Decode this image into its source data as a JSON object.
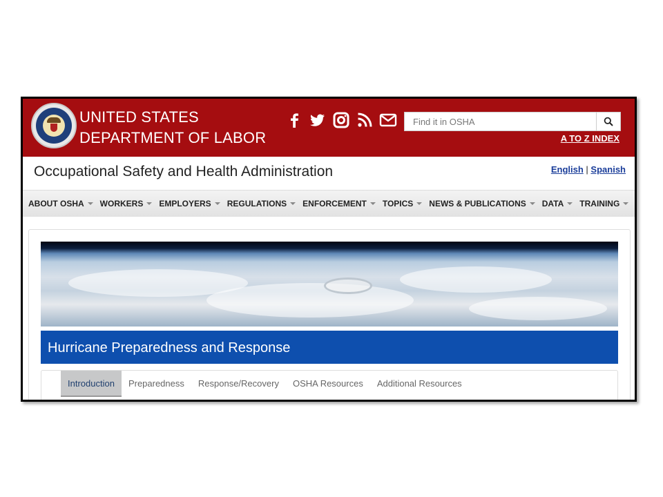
{
  "header": {
    "agency_line1": "UNITED STATES",
    "agency_line2": "DEPARTMENT OF LABOR",
    "atoz_label": "A TO Z INDEX",
    "search": {
      "placeholder": "Find it in OSHA",
      "value": ""
    },
    "social": [
      "facebook-icon",
      "twitter-icon",
      "instagram-icon",
      "rss-icon",
      "email-icon"
    ],
    "colors": {
      "bar": "#a50d10"
    }
  },
  "subheader": {
    "title": "Occupational Safety and Health Administration",
    "lang_english": "English",
    "lang_separator": "|",
    "lang_spanish": "Spanish"
  },
  "nav": {
    "items": [
      {
        "label": "ABOUT OSHA"
      },
      {
        "label": "WORKERS"
      },
      {
        "label": "EMPLOYERS"
      },
      {
        "label": "REGULATIONS"
      },
      {
        "label": "ENFORCEMENT"
      },
      {
        "label": "TOPICS"
      },
      {
        "label": "NEWS & PUBLICATIONS"
      },
      {
        "label": "DATA"
      },
      {
        "label": "TRAINING"
      }
    ]
  },
  "page": {
    "banner_title": "Hurricane Preparedness and Response",
    "banner_color": "#0e4fae",
    "tabs": [
      {
        "label": "Introduction",
        "active": true
      },
      {
        "label": "Preparedness",
        "active": false
      },
      {
        "label": "Response/Recovery",
        "active": false
      },
      {
        "label": "OSHA Resources",
        "active": false
      },
      {
        "label": "Additional Resources",
        "active": false
      }
    ]
  }
}
